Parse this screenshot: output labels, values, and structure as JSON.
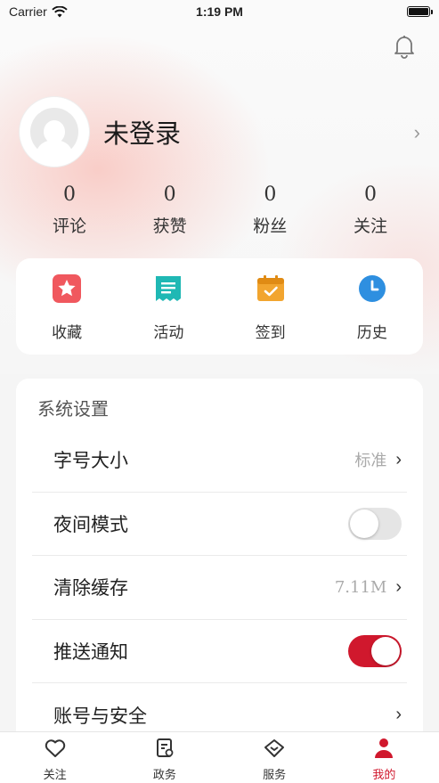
{
  "status_bar": {
    "carrier": "Carrier",
    "time": "1:19 PM"
  },
  "profile": {
    "username": "未登录"
  },
  "stats": [
    {
      "value": "0",
      "label": "评论"
    },
    {
      "value": "0",
      "label": "获赞"
    },
    {
      "value": "0",
      "label": "粉丝"
    },
    {
      "value": "0",
      "label": "关注"
    }
  ],
  "quick_actions": [
    {
      "label": "收藏",
      "icon": "star-icon",
      "color": "#f0585e"
    },
    {
      "label": "活动",
      "icon": "receipt-icon",
      "color": "#1fb8b4"
    },
    {
      "label": "签到",
      "icon": "calendar-check-icon",
      "color": "#f2a52f"
    },
    {
      "label": "历史",
      "icon": "clock-icon",
      "color": "#2e8fe0"
    }
  ],
  "settings": {
    "title": "系统设置",
    "rows": [
      {
        "label": "字号大小",
        "value": "标准",
        "control": "chevron"
      },
      {
        "label": "夜间模式",
        "value": "",
        "control": "toggle",
        "on": false
      },
      {
        "label": "清除缓存",
        "value": "7.11M",
        "control": "chevron"
      },
      {
        "label": "推送通知",
        "value": "",
        "control": "toggle",
        "on": true
      },
      {
        "label": "账号与安全",
        "value": "",
        "control": "chevron"
      }
    ]
  },
  "tabs": [
    {
      "label": "关注",
      "icon": "heart-icon",
      "active": false
    },
    {
      "label": "政务",
      "icon": "document-icon",
      "active": false
    },
    {
      "label": "服务",
      "icon": "diamond-icon",
      "active": false
    },
    {
      "label": "我的",
      "icon": "person-icon",
      "active": true
    }
  ],
  "colors": {
    "accent": "#d0182d"
  }
}
